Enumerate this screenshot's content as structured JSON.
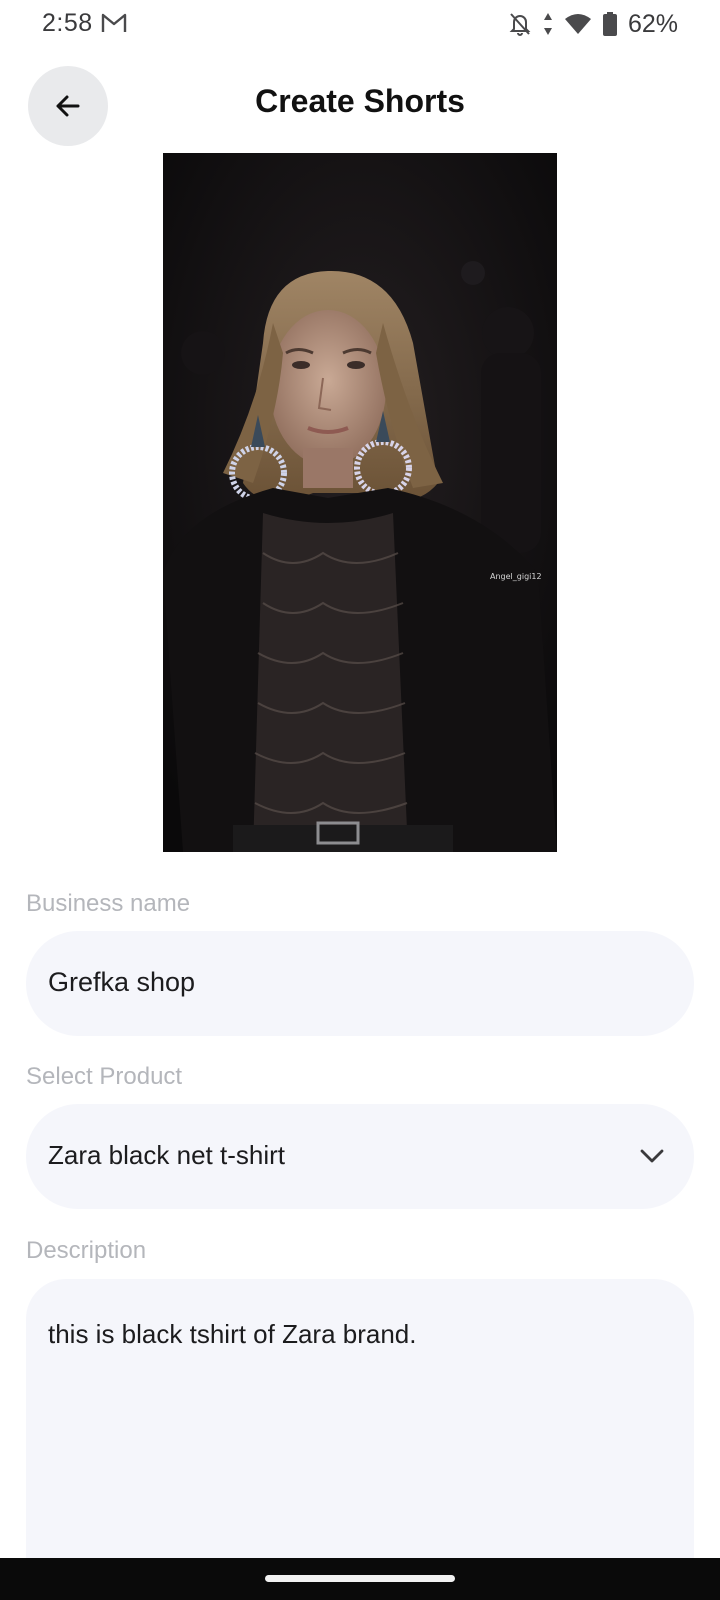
{
  "status_bar": {
    "time": "2:58",
    "battery": "62%",
    "icons": [
      "gmail-icon",
      "bell-off-icon",
      "data-arrows-icon",
      "wifi-icon",
      "battery-icon"
    ]
  },
  "header": {
    "title": "Create Shorts",
    "back_icon": "arrow-left-icon"
  },
  "video": {
    "watermark": "Angel_gigi12"
  },
  "form": {
    "business_name": {
      "label": "Business name",
      "value": "Grefka shop"
    },
    "product": {
      "label": "Select Product",
      "value": "Zara black net t-shirt",
      "icon": "chevron-down-icon"
    },
    "description": {
      "label": "Description",
      "value": "this is black tshirt of Zara brand."
    }
  },
  "colors": {
    "field_background": "#f5f6fb",
    "label_color": "#b4b6bb",
    "back_button_bg": "#e9eaec",
    "nav_bar": "#0a0a0a"
  }
}
